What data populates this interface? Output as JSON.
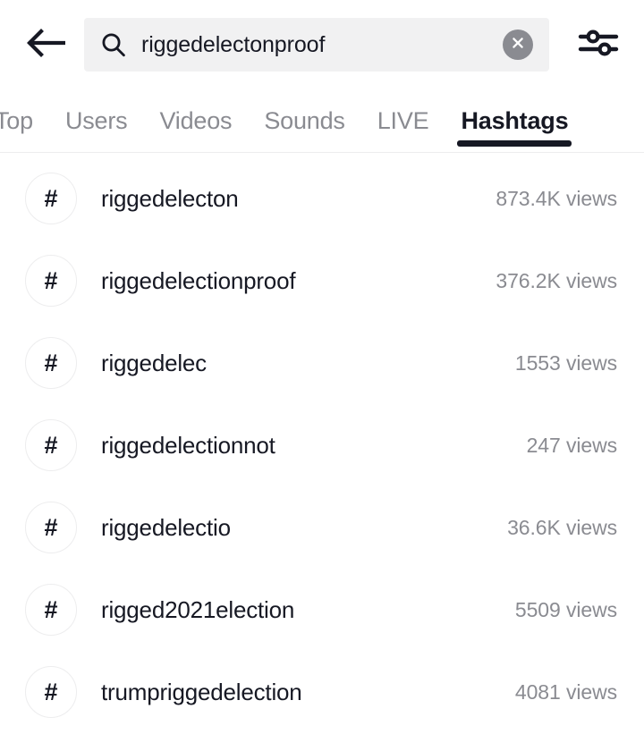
{
  "header": {
    "back_icon": "back-arrow-icon",
    "search": {
      "icon": "search-icon",
      "value": "riggedelectonproof",
      "placeholder": "Search",
      "clear_icon": "close-circle-icon"
    },
    "filter_icon": "filter-sliders-icon"
  },
  "tabs": {
    "items": [
      {
        "label": "Top",
        "active": false
      },
      {
        "label": "Users",
        "active": false
      },
      {
        "label": "Videos",
        "active": false
      },
      {
        "label": "Sounds",
        "active": false
      },
      {
        "label": "LIVE",
        "active": false
      },
      {
        "label": "Hashtags",
        "active": true
      }
    ],
    "active_label": "Hashtags"
  },
  "results": {
    "rows": [
      {
        "hash": "#",
        "name": "riggedelecton",
        "views": "873.4K views"
      },
      {
        "hash": "#",
        "name": "riggedelectionproof",
        "views": "376.2K views"
      },
      {
        "hash": "#",
        "name": "riggedelec",
        "views": "1553 views"
      },
      {
        "hash": "#",
        "name": "riggedelectionnot",
        "views": "247 views"
      },
      {
        "hash": "#",
        "name": "riggedelectio",
        "views": "36.6K views"
      },
      {
        "hash": "#",
        "name": "rigged2021election",
        "views": "5509 views"
      },
      {
        "hash": "#",
        "name": "trumpriggedelection",
        "views": "4081 views"
      }
    ]
  },
  "colors": {
    "text_primary": "#161823",
    "text_secondary": "#8a8b91",
    "search_bg": "#f1f1f2",
    "divider": "#ededee",
    "page_bg": "#ffffff"
  }
}
